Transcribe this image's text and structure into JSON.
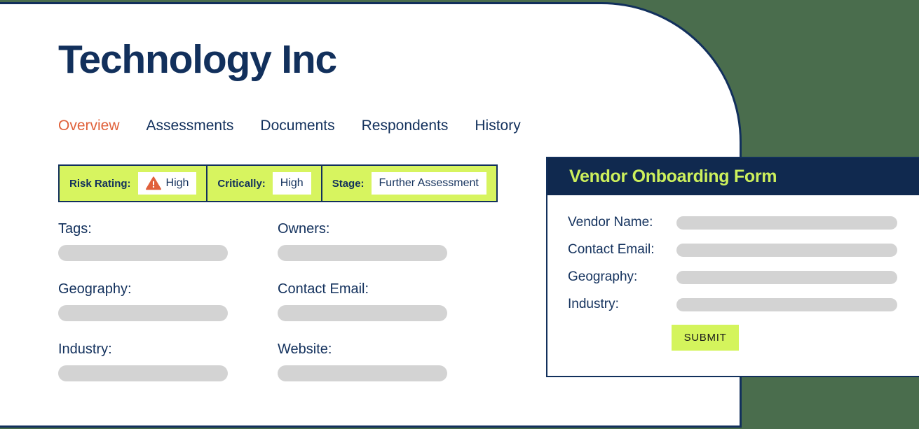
{
  "theme": {
    "background_green": "#4a6d4d",
    "navy": "#12305c",
    "lime": "#d7f45f",
    "accent_orange": "#e0613a",
    "placeholder_gray": "#d3d3d3"
  },
  "profile": {
    "title": "Technology Inc",
    "tabs": [
      {
        "label": "Overview",
        "active": true
      },
      {
        "label": "Assessments",
        "active": false
      },
      {
        "label": "Documents",
        "active": false
      },
      {
        "label": "Respondents",
        "active": false
      },
      {
        "label": "History",
        "active": false
      }
    ],
    "status_bar": [
      {
        "label": "Risk Rating:",
        "value": "High",
        "icon": "warning-triangle-icon"
      },
      {
        "label": "Critically:",
        "value": "High",
        "icon": ""
      },
      {
        "label": "Stage:",
        "value": "Further Assessment",
        "icon": ""
      }
    ],
    "fields": [
      {
        "label": "Tags:",
        "value": ""
      },
      {
        "label": "Owners:",
        "value": ""
      },
      {
        "label": "Geography:",
        "value": ""
      },
      {
        "label": "Contact Email:",
        "value": ""
      },
      {
        "label": "Industry:",
        "value": ""
      },
      {
        "label": "Website:",
        "value": ""
      }
    ]
  },
  "vendor_form": {
    "title": "Vendor Onboarding Form",
    "fields": [
      {
        "label": "Vendor Name:",
        "value": ""
      },
      {
        "label": "Contact Email:",
        "value": ""
      },
      {
        "label": "Geography:",
        "value": ""
      },
      {
        "label": "Industry:",
        "value": ""
      }
    ],
    "submit_label": "SUBMIT"
  }
}
